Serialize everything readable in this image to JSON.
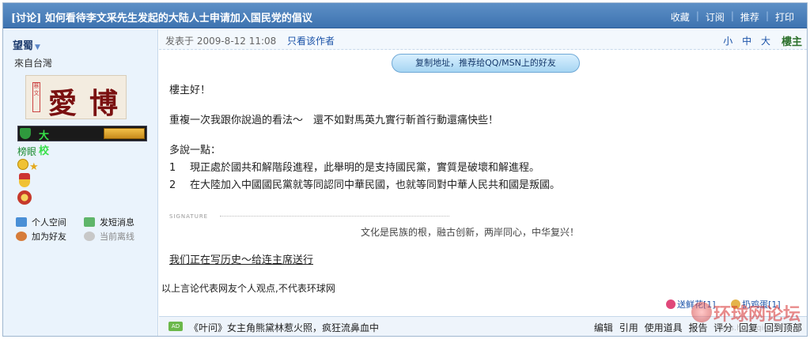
{
  "thread": {
    "title": "[讨论] 如何看待李文采先生发起的大陆人士申请加入国民党的倡议",
    "actions": [
      "收藏",
      "订阅",
      "推荐",
      "打印"
    ]
  },
  "user": {
    "name": "望蜀",
    "from": "來自台灣",
    "avatar_chars": [
      "愛",
      "博"
    ],
    "avatar_seal": "蔡文",
    "rank_text": "大 校",
    "title": "榜眼",
    "links": {
      "space": "个人空间",
      "message": "发短消息",
      "add_friend": "加为好友",
      "status": "当前离线"
    }
  },
  "post": {
    "time": "发表于 2009-8-12 11:08",
    "only_author": "只看该作者",
    "font_sizes": [
      "小",
      "中",
      "大"
    ],
    "floor": "樓主",
    "copy_button": "复制地址，推荐给QQ/MSN上的好友",
    "greeting": "樓主好！",
    "para1": "重複一次我跟你說過的看法～　還不如對馬英九實行斬首行動還痛快些！",
    "para2": "多說一點：",
    "items": [
      {
        "num": "1",
        "text": "現正處於國共和解階段進程，此舉明的是支持國民黨，實質是破壞和解進程。"
      },
      {
        "num": "2",
        "text": "在大陸加入中國國民黨就等同認同中華民國，也就等同對中華人民共和國是叛國。"
      }
    ],
    "signature_label": "SIGNATURE",
    "signature": "文化是民族的根，融古创新，两岸同心，中华复兴！",
    "history_link": "我们正在写历史～给连主席送行",
    "disclaimer": "以上言论代表网友个人观点,不代表环球网"
  },
  "votes": {
    "flower": "送鲜花[1]",
    "egg": "扔鸡蛋[1]"
  },
  "bottom": {
    "ad_tag": "AD",
    "ad_text": "《叶问》女主角熊黛林惹火照，疯狂流鼻血中",
    "ops": [
      "编辑",
      "引用",
      "使用道具",
      "报告",
      "评分",
      "回复",
      "回到顶部"
    ]
  },
  "watermark": {
    "brand": "环球网论坛",
    "url": "bbs.huanqiu.com"
  },
  "colors": {
    "titlebar": "#4a7fbb",
    "sidebar": "#eaf3fc",
    "link": "#1a52a8"
  }
}
